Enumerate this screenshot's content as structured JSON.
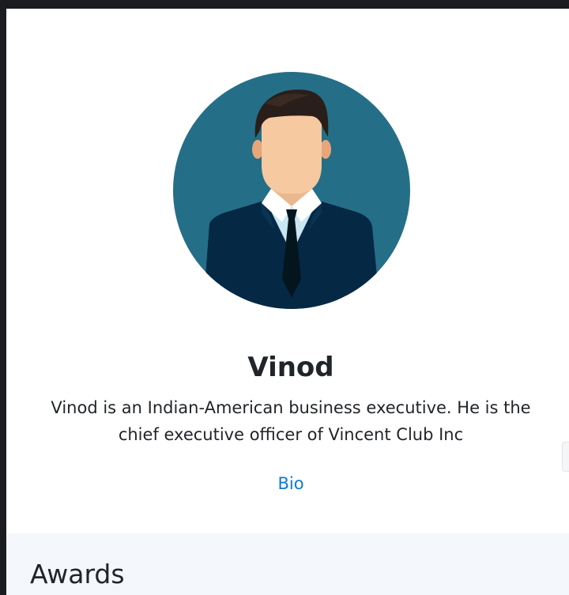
{
  "profile": {
    "avatar_icon": "businessman-avatar-icon",
    "name": "Vinod",
    "description": "Vinod is an Indian-American business executive. He is the chief executive officer of Vincent Club Inc",
    "bio_link_label": "Bio"
  },
  "awards": {
    "title": "Awards"
  },
  "colors": {
    "avatar_background": "#246f87",
    "suit": "#052845",
    "link": "#0d7bd1",
    "awards_background": "#f4f8fd"
  }
}
